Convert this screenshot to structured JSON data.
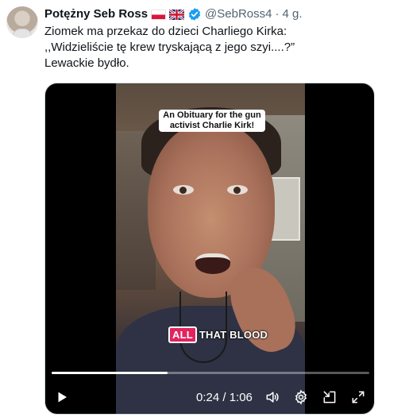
{
  "author": {
    "name": "Potężny Seb Ross",
    "handle": "@SebRoss4",
    "time": "4 g.",
    "separator": "·"
  },
  "tweet": {
    "lines": [
      "Ziomek ma przekaz do dzieci Charliego Kirka:",
      ",,Widzieliście tę krew tryskającą z jego szyi....?”",
      "Lewackie bydło."
    ]
  },
  "video": {
    "caption_top": "An Obituary for the gun activist Charlie Kirk!",
    "caption_highlight": "ALL",
    "caption_rest": "THAT BLOOD",
    "current_time": "0:24",
    "duration": "1:06",
    "timecode": "0:24 / 1:06",
    "progress": 0.364
  },
  "icons": {
    "flags": [
      "poland-flag-icon",
      "uk-flag-icon"
    ],
    "verified": "verified-badge-icon",
    "controls": [
      "play-icon",
      "volume-icon",
      "settings-icon",
      "pip-icon",
      "fullscreen-icon"
    ]
  },
  "colors": {
    "verified_blue": "#1d9bf0",
    "text_secondary": "#536471",
    "caption_highlight": "#e0245e"
  }
}
